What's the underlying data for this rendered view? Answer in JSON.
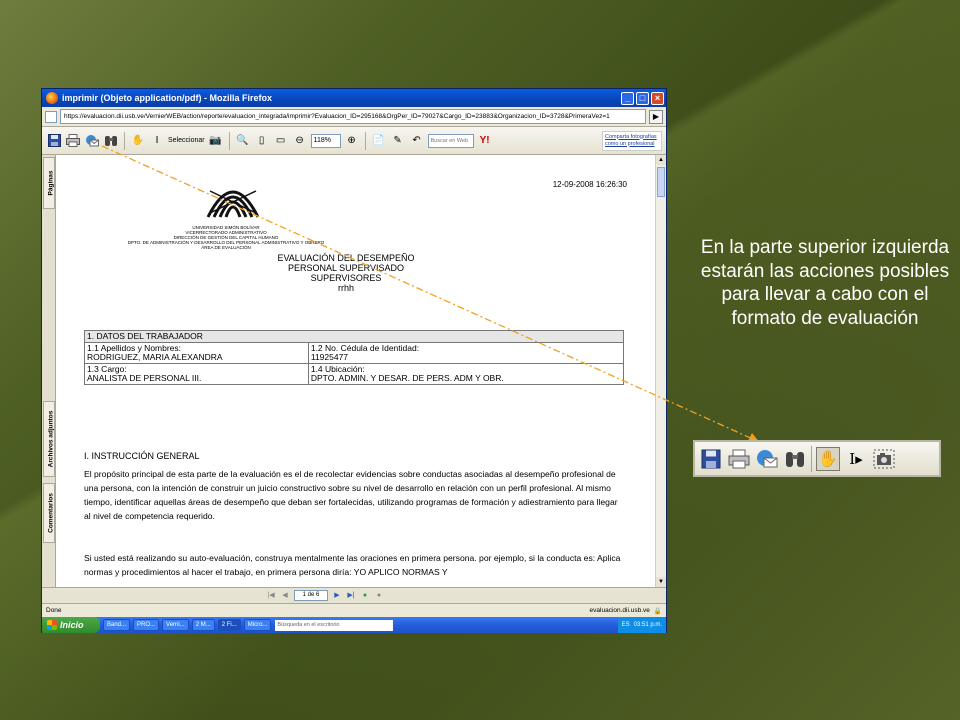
{
  "window": {
    "title": "imprimir (Objeto application/pdf) - Mozilla Firefox",
    "url": "https://evaluacion.dii.usb.ve/VernierWEB/action/reporte/evaluacion_integrada/imprimir?Evaluacion_ID=295168&OrgPer_ID=79027&Cargo_ID=23883&Organizacion_ID=3728&PrimeraVez=1"
  },
  "pdf_toolbar": {
    "select_label": "Seleccionar",
    "zoom_value": "118%",
    "search_placeholder": "Buscar en Web",
    "promo_text": "Comparta fotografías como un profesional"
  },
  "side_tabs": {
    "pages": "Páginas",
    "attachments": "Archivos adjuntos",
    "comments": "Comentarios"
  },
  "document": {
    "date": "12-09-2008 16:26:30",
    "institution_lines": [
      "UNIVERSIDAD SIMÓN BOLÍVAR",
      "VICERRECTORADO ADMINISTRATIVO",
      "DIRECCIÓN DE GESTIÓN DEL CAPITAL HUMANO",
      "DPTO. DE ADMINISTRACIÓN Y DESARROLLO DEL PERSONAL ADMINISTRATIVO Y OBRERO",
      "ÁREA DE EVALUACIÓN"
    ],
    "heading_lines": [
      "EVALUACIÓN DEL DESEMPEÑO",
      "PERSONAL SUPERVISADO",
      "SUPERVISORES",
      "rrhh"
    ],
    "table": {
      "header": "1. DATOS DEL TRABAJADOR",
      "name_label": "1.1 Apellidos y Nombres:",
      "name_value": "RODRIGUEZ, MARIA ALEXANDRA",
      "id_label": "1.2 No. Cédula de Identidad:",
      "id_value": "11925477",
      "position_label": "1.3 Cargo:",
      "position_value": "ANALISTA DE PERSONAL III.",
      "location_label": "1.4 Ubicación:",
      "location_value": "DPTO. ADMIN. Y DESAR. DE PERS. ADM Y OBR."
    },
    "section_title": "I. INSTRUCCIÓN GENERAL",
    "paragraph1": "El propósito principal de esta parte de la evaluación es el de recolectar evidencias sobre conductas asociadas al desempeño profesional de una persona, con la intención de construir un juicio constructivo sobre su nivel de desarrollo en relación con un perfil profesional. Al mismo tiempo, identificar aquellas áreas de desempeño que deban ser fortalecidas, utilizando programas de formación y adiestramiento para llegar al nivel de competencia requerido.",
    "paragraph2": "Si usted está realizando su auto-evaluación, construya mentalmente las oraciones en primera persona. por ejemplo, si la conducta es: Aplica normas y procedimientos al hacer el trabajo, en primera persona diría: YO APLICO NORMAS Y"
  },
  "page_nav": {
    "page_display": "1 de 6"
  },
  "status": {
    "left": "Done",
    "right": "evaluacion.dii.usb.ve"
  },
  "taskbar": {
    "start": "Inicio",
    "buttons": [
      "Band...",
      "PRO...",
      "Verni...",
      "2 M...",
      "2 Fi...",
      "Micro..."
    ],
    "search_placeholder": "Búsqueda en el escritorio",
    "lang": "ES",
    "clock": "03:51 p.m."
  },
  "caption": "En la parte superior izquierda estarán las acciones posibles para llevar a cabo con el formato de evaluación",
  "colors": {
    "slide_bg": "#4e5f24",
    "arrow": "#f0a020",
    "titlebar": "#0a5ce0"
  }
}
